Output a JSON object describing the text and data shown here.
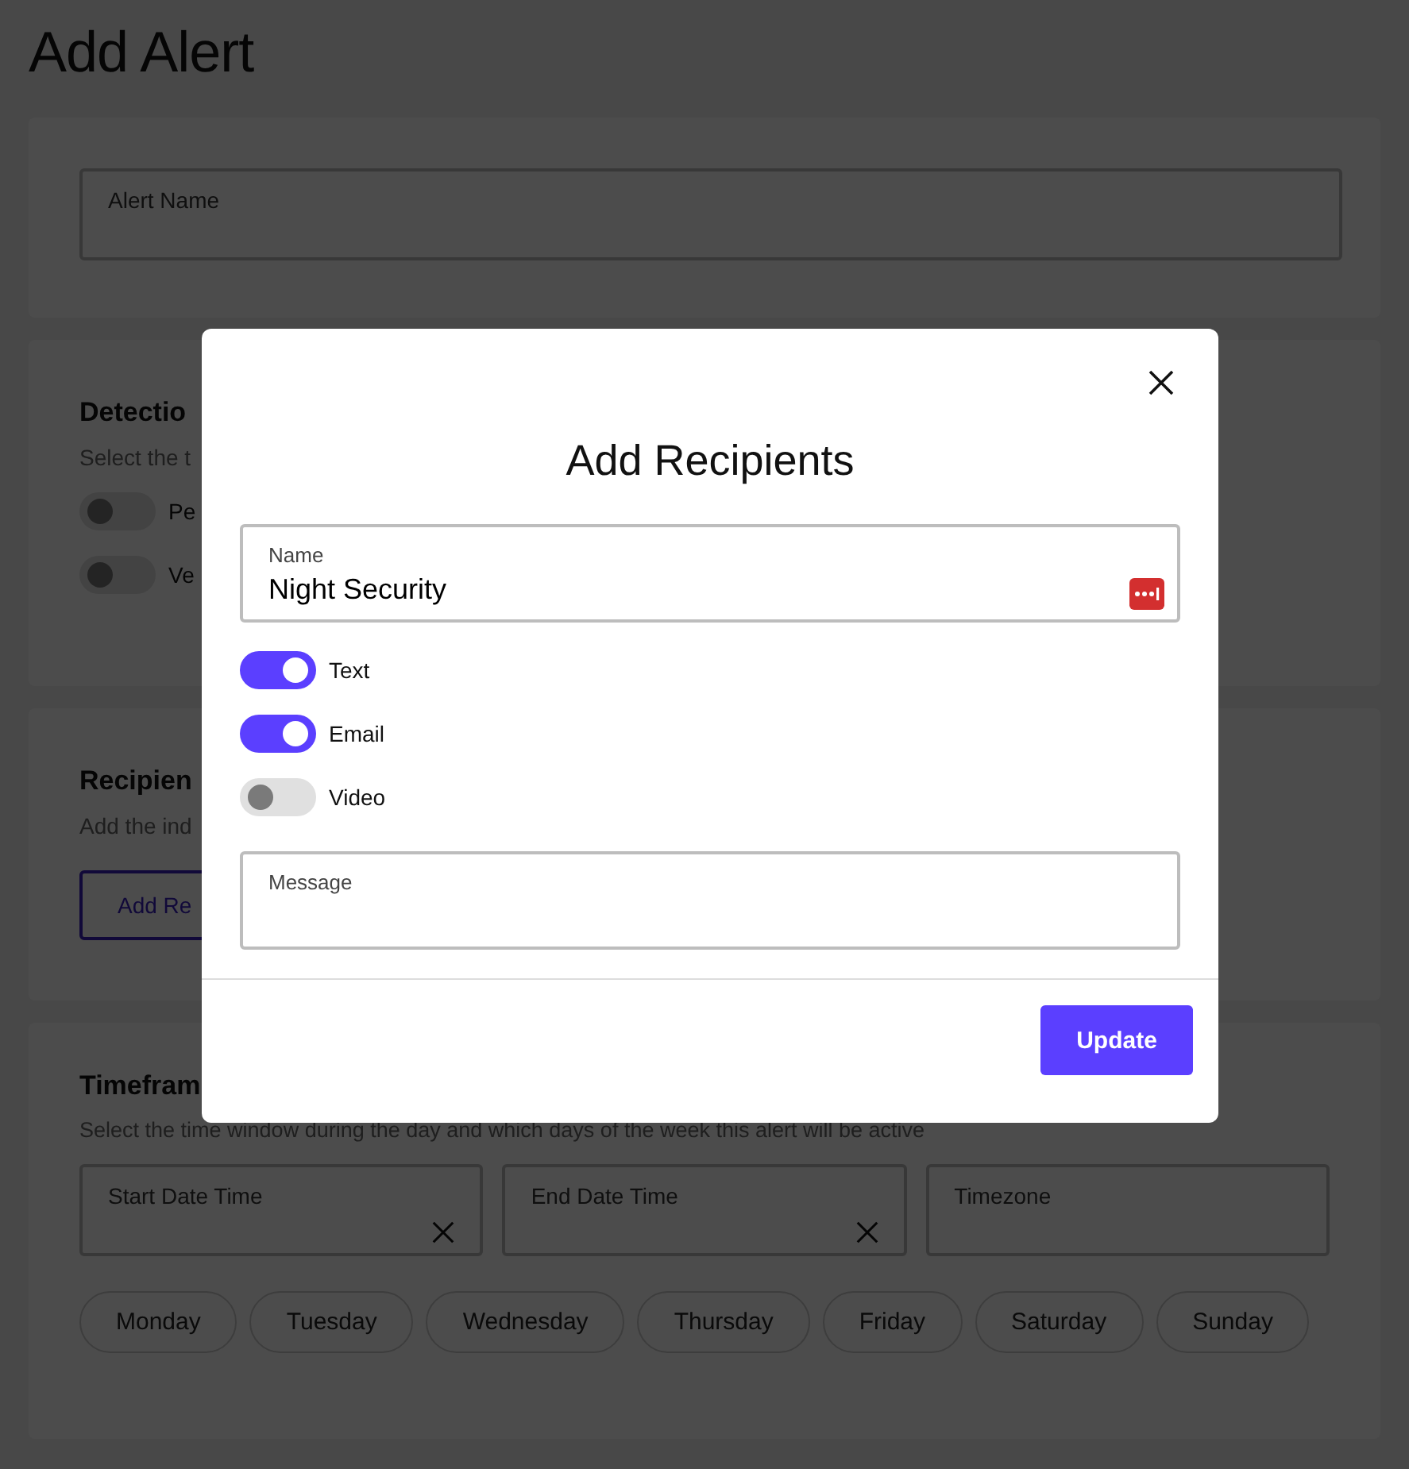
{
  "page": {
    "title": "Add Alert"
  },
  "alert_name": {
    "placeholder": "Alert Name"
  },
  "detection": {
    "heading": "Detectio",
    "description": "Select the t",
    "toggles": [
      {
        "label": "Pe",
        "on": false
      },
      {
        "label": "Ve",
        "on": false
      }
    ]
  },
  "recipients": {
    "heading": "Recipien",
    "description": "Add the ind",
    "button": "Add Re"
  },
  "timeframe": {
    "heading": "Timefram",
    "description": "Select the time window during the day and which days of the week this alert will be active",
    "fields": [
      {
        "placeholder": "Start Date Time",
        "clearable": true
      },
      {
        "placeholder": "End Date Time",
        "clearable": true
      },
      {
        "placeholder": "Timezone",
        "clearable": false
      }
    ],
    "days": [
      {
        "label": "Monday",
        "selected": false
      },
      {
        "label": "Tuesday",
        "selected": false
      },
      {
        "label": "Wednesday",
        "selected": false
      },
      {
        "label": "Thursday",
        "selected": false
      },
      {
        "label": "Friday",
        "selected": false
      },
      {
        "label": "Saturday",
        "selected": false
      },
      {
        "label": "Sunday",
        "selected": false
      }
    ]
  },
  "modal": {
    "title": "Add Recipients",
    "name_field": {
      "label": "Name",
      "value": "Night Security"
    },
    "toggles": [
      {
        "label": "Text",
        "on": true
      },
      {
        "label": "Email",
        "on": true
      },
      {
        "label": "Video",
        "on": false
      }
    ],
    "message_field": {
      "placeholder": "Message"
    },
    "button": "Update"
  }
}
